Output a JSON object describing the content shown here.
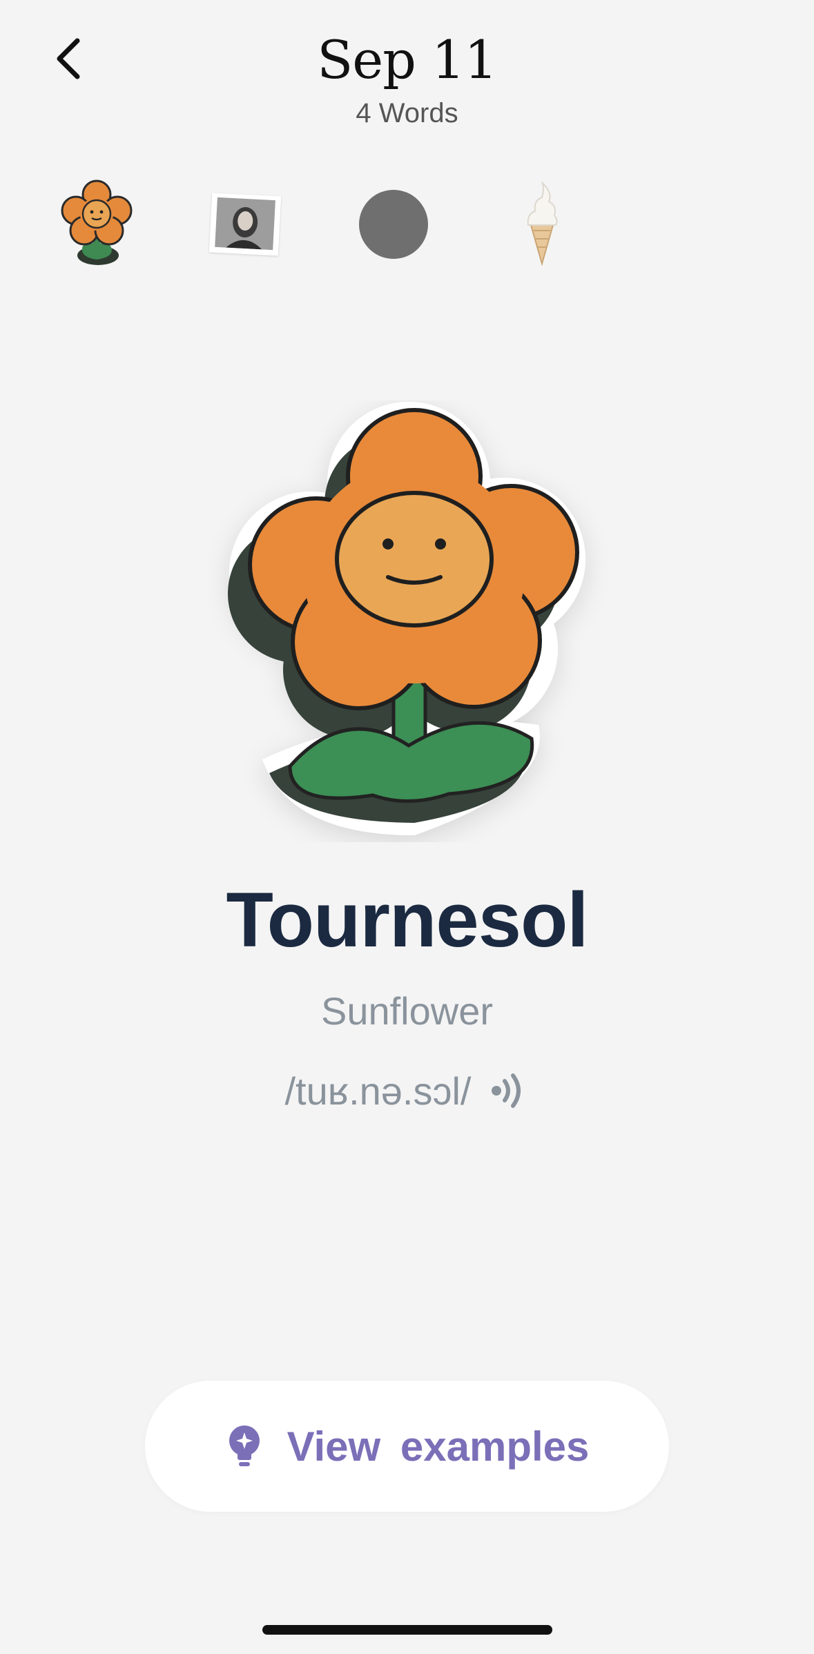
{
  "header": {
    "title": "Sep 11",
    "subtitle": "4 Words"
  },
  "thumbnails": [
    {
      "name": "flower-pin",
      "selected": true
    },
    {
      "name": "portrait-photo",
      "selected": false
    },
    {
      "name": "gray-circle",
      "selected": false
    },
    {
      "name": "ice-cream",
      "selected": false
    }
  ],
  "word": {
    "term": "Tournesol",
    "translation": "Sunflower",
    "pronunciation": "/tuʁ.nə.sɔl/"
  },
  "actions": {
    "examples_label": "View examples"
  },
  "colors": {
    "background": "#f4f4f4",
    "word": "#1b2a41",
    "muted": "#8a939c",
    "accent": "#7b6fb8"
  },
  "icons": {
    "back": "chevron-left-icon",
    "speaker": "speaker-icon",
    "examples": "lightbulb-icon"
  }
}
